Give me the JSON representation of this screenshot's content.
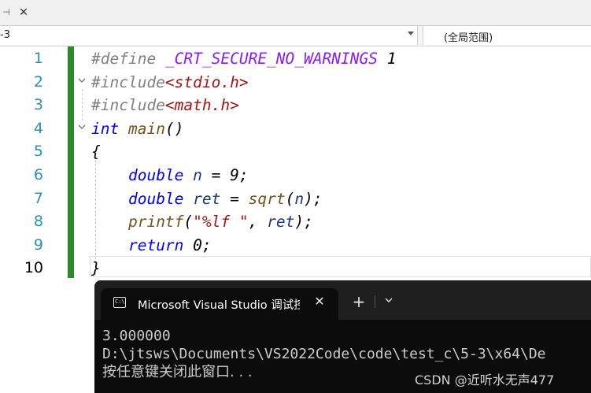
{
  "tabstrip": {
    "pin_glyph": "⊣",
    "close_glyph": "✕"
  },
  "navbar": {
    "project_value": "-3",
    "scope_value": "(全局范围)"
  },
  "editor": {
    "line_numbers": [
      "1",
      "2",
      "3",
      "4",
      "5",
      "6",
      "7",
      "8",
      "9",
      "10"
    ],
    "current_line": "10",
    "lines": [
      [
        [
          "pre",
          "#define "
        ],
        [
          "macro",
          "_CRT_SECURE_NO_WARNINGS"
        ],
        [
          "num",
          " 1"
        ]
      ],
      [
        [
          "pre",
          "#include"
        ],
        [
          "str",
          "<stdio.h>"
        ]
      ],
      [
        [
          "pre",
          "#include"
        ],
        [
          "str",
          "<math.h>"
        ]
      ],
      [
        [
          "kw",
          "int"
        ],
        [
          "txt",
          " "
        ],
        [
          "fn",
          "main"
        ],
        [
          "txt",
          "()"
        ]
      ],
      [
        [
          "txt",
          "{"
        ]
      ],
      [
        [
          "txt",
          "    "
        ],
        [
          "kw",
          "double"
        ],
        [
          "txt",
          " "
        ],
        [
          "var",
          "n"
        ],
        [
          "txt",
          " = 9;"
        ]
      ],
      [
        [
          "txt",
          "    "
        ],
        [
          "kw",
          "double"
        ],
        [
          "txt",
          " "
        ],
        [
          "var",
          "ret"
        ],
        [
          "txt",
          " = "
        ],
        [
          "fn",
          "sqrt"
        ],
        [
          "txt",
          "("
        ],
        [
          "var",
          "n"
        ],
        [
          "txt",
          ");"
        ]
      ],
      [
        [
          "txt",
          "    "
        ],
        [
          "fn",
          "printf"
        ],
        [
          "txt",
          "("
        ],
        [
          "str",
          "\"%lf \""
        ],
        [
          "txt",
          ", "
        ],
        [
          "var",
          "ret"
        ],
        [
          "txt",
          ");"
        ]
      ],
      [
        [
          "txt",
          "    "
        ],
        [
          "kw",
          "return"
        ],
        [
          "txt",
          " 0;"
        ]
      ],
      [
        [
          "txt",
          "}"
        ]
      ]
    ]
  },
  "console": {
    "icon_glyph": "C:\\",
    "tab_title": "Microsoft Visual Studio 调试控制台",
    "close_glyph": "✕",
    "new_tab_glyph": "+",
    "dropdown_glyph": "⌄",
    "output": [
      "3.000000",
      "D:\\jtsws\\Documents\\VS2022Code\\code\\test_c\\5-3\\x64\\De",
      "按任意键关闭此窗口. . ."
    ]
  },
  "watermark": "CSDN @近听水无声477"
}
